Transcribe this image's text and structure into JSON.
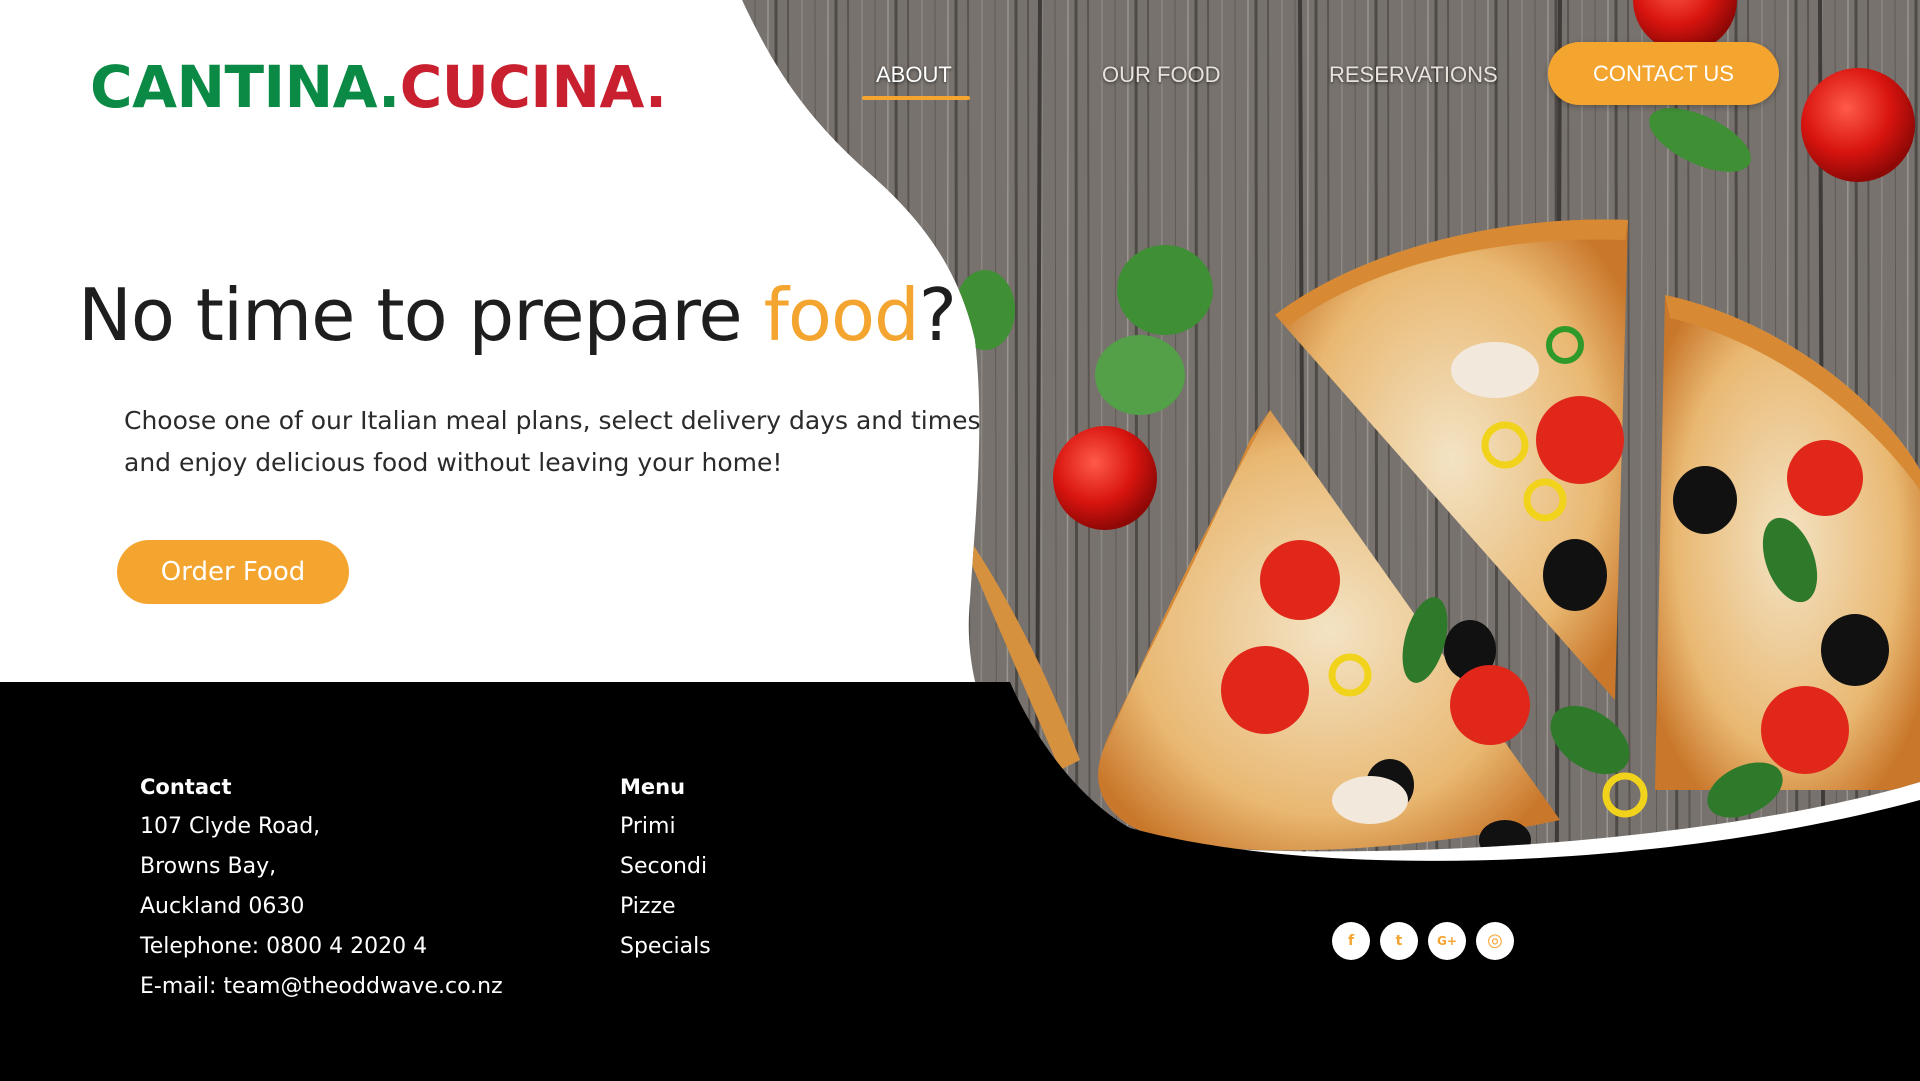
{
  "brand": {
    "name_part1": "CANTINA.",
    "name_part2": "CUCINA.",
    "green": "#0a8a45",
    "red": "#c9202f"
  },
  "nav": {
    "items": [
      {
        "label": "ABOUT",
        "active": true
      },
      {
        "label": "OUR FOOD",
        "active": false
      },
      {
        "label": "RESERVATIONS",
        "active": false
      }
    ],
    "contact_label": "CONTACT US"
  },
  "hero": {
    "headline_pre": "No time to prepare ",
    "headline_accent": "food",
    "headline_post": "?",
    "subtext_line1": "Choose one of our Italian meal plans, select delivery days and times",
    "subtext_line2": "and enjoy delicious food without leaving your home!",
    "cta_label": "Order Food"
  },
  "footer": {
    "contact": {
      "title": "Contact",
      "lines": [
        "107 Clyde Road,",
        "Browns Bay,",
        "Auckland 0630",
        "Telephone: 0800 4 2020 4",
        "E-mail: team@theoddwave.co.nz"
      ]
    },
    "menu": {
      "title": "Menu",
      "items": [
        "Primi",
        "Secondi",
        "Pizze",
        "Specials"
      ]
    },
    "social": [
      {
        "icon": "facebook-icon",
        "glyph": "f"
      },
      {
        "icon": "twitter-icon",
        "glyph": "t"
      },
      {
        "icon": "google-plus-icon",
        "glyph": "G+"
      },
      {
        "icon": "instagram-icon",
        "glyph": "◎"
      }
    ]
  },
  "colors": {
    "accent": "#f4a52f",
    "footer_bg": "#000000",
    "text_dark": "#1e1e1e"
  }
}
